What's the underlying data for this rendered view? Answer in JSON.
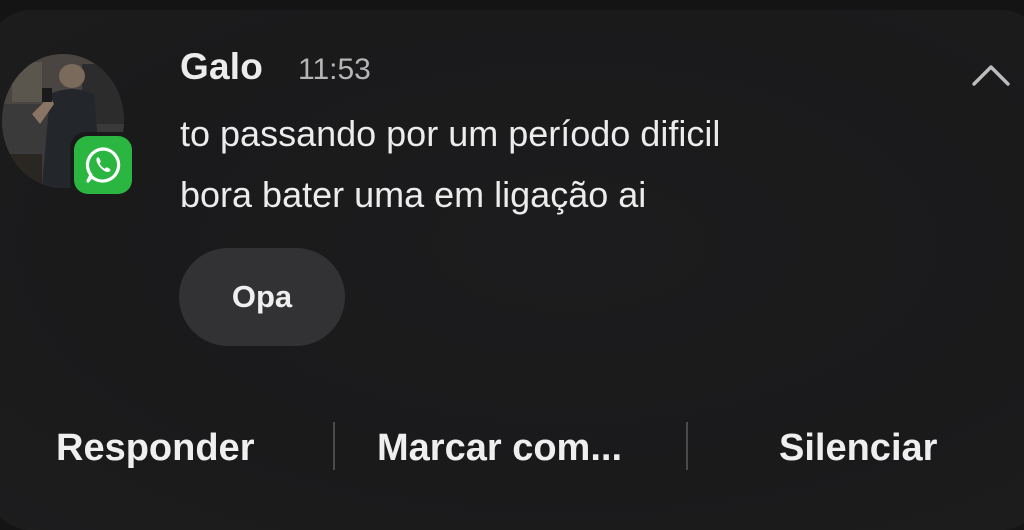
{
  "notification": {
    "sender": "Galo",
    "time": "11:53",
    "app_icon": "whatsapp-icon",
    "messages": [
      "to passando por um período dificil",
      "bora bater uma em ligação ai"
    ],
    "quick_reply": "Opa"
  },
  "actions": {
    "reply": "Responder",
    "mark": "Marcar com...",
    "mute": "Silenciar"
  },
  "colors": {
    "whatsapp_green": "#2bb641",
    "card_bg": "#1a1a1b",
    "chip_bg": "#323234"
  }
}
